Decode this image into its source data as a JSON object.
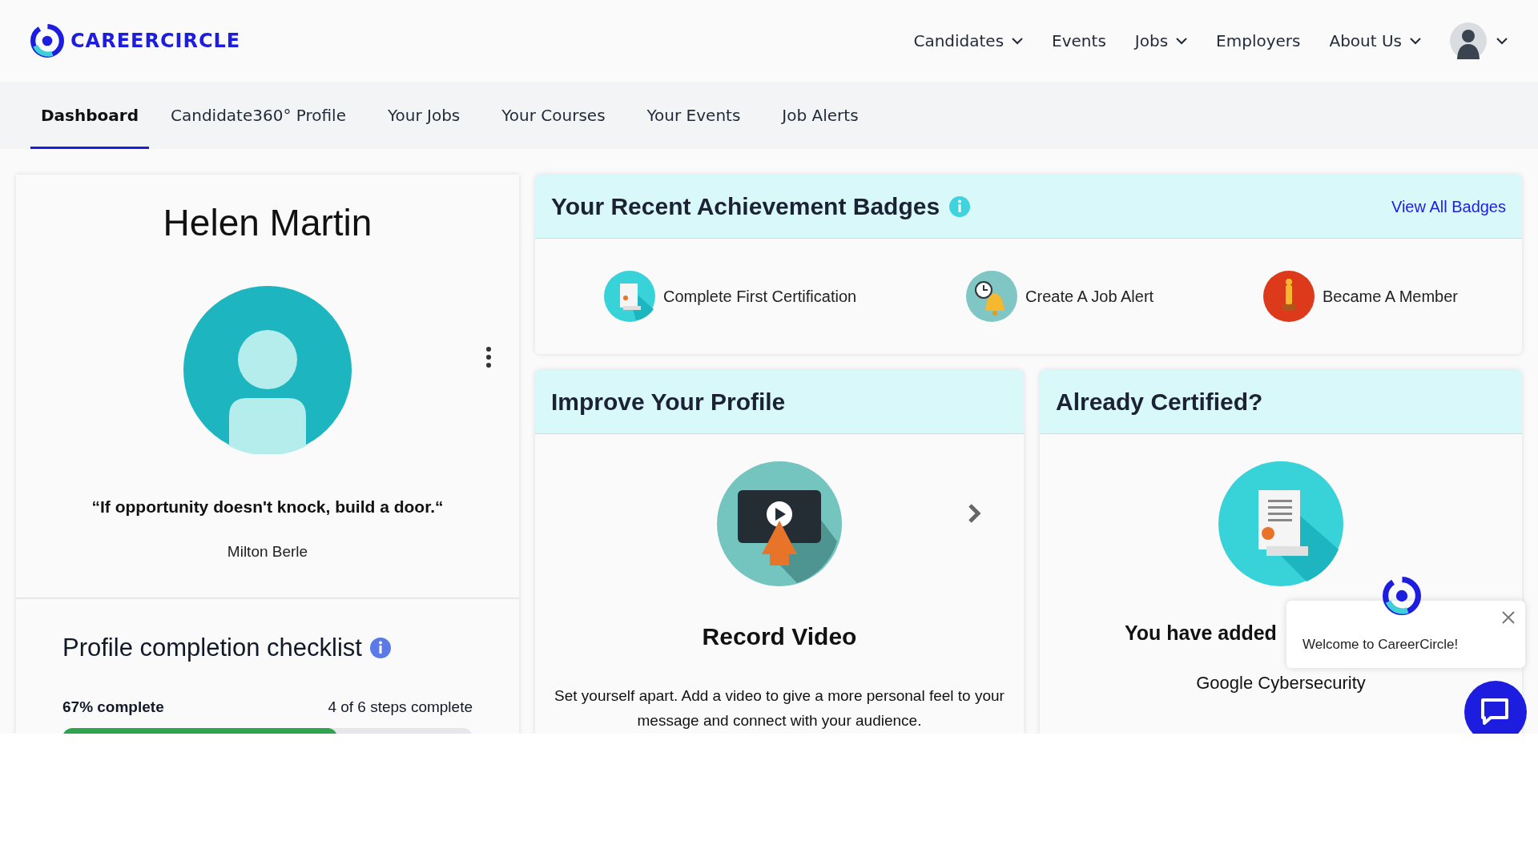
{
  "header": {
    "logo_text": "CAREERCIRCLE",
    "nav": [
      {
        "label": "Candidates",
        "dropdown": true
      },
      {
        "label": "Events",
        "dropdown": false
      },
      {
        "label": "Jobs",
        "dropdown": true
      },
      {
        "label": "Employers",
        "dropdown": false
      },
      {
        "label": "About Us",
        "dropdown": true
      }
    ]
  },
  "tabs": [
    {
      "label": "Dashboard",
      "selected": true
    },
    {
      "label": "Candidate360° Profile",
      "selected": false
    },
    {
      "label": "Your Jobs",
      "selected": false
    },
    {
      "label": "Your Courses",
      "selected": false
    },
    {
      "label": "Your Events",
      "selected": false
    },
    {
      "label": "Job Alerts",
      "selected": false
    }
  ],
  "profile": {
    "name": "Helen Martin",
    "quote": "“If opportunity doesn't knock, build a door.“",
    "author": "Milton Berle"
  },
  "checklist": {
    "title": "Profile completion checklist",
    "percent_text": "67% complete",
    "steps_text": "4 of 6 steps complete",
    "level": 0.67
  },
  "badges": {
    "title": "Your Recent Achievement Badges",
    "link": "View All Badges",
    "items": [
      {
        "label": "Complete First Certification",
        "kind": "certificate"
      },
      {
        "label": "Create A Job Alert",
        "kind": "alarm"
      },
      {
        "label": "Became A Member",
        "kind": "trophy"
      }
    ]
  },
  "improve": {
    "title": "Improve Your Profile",
    "item_title": "Record Video",
    "description": "Set yourself apart. Add a video to give a more personal feel to your message and connect with your audience."
  },
  "certified": {
    "title": "Already Certified?",
    "heading": "You have added",
    "course": "Google Cybersecurity"
  },
  "chat": {
    "message": "Welcome to CareerCircle!"
  }
}
